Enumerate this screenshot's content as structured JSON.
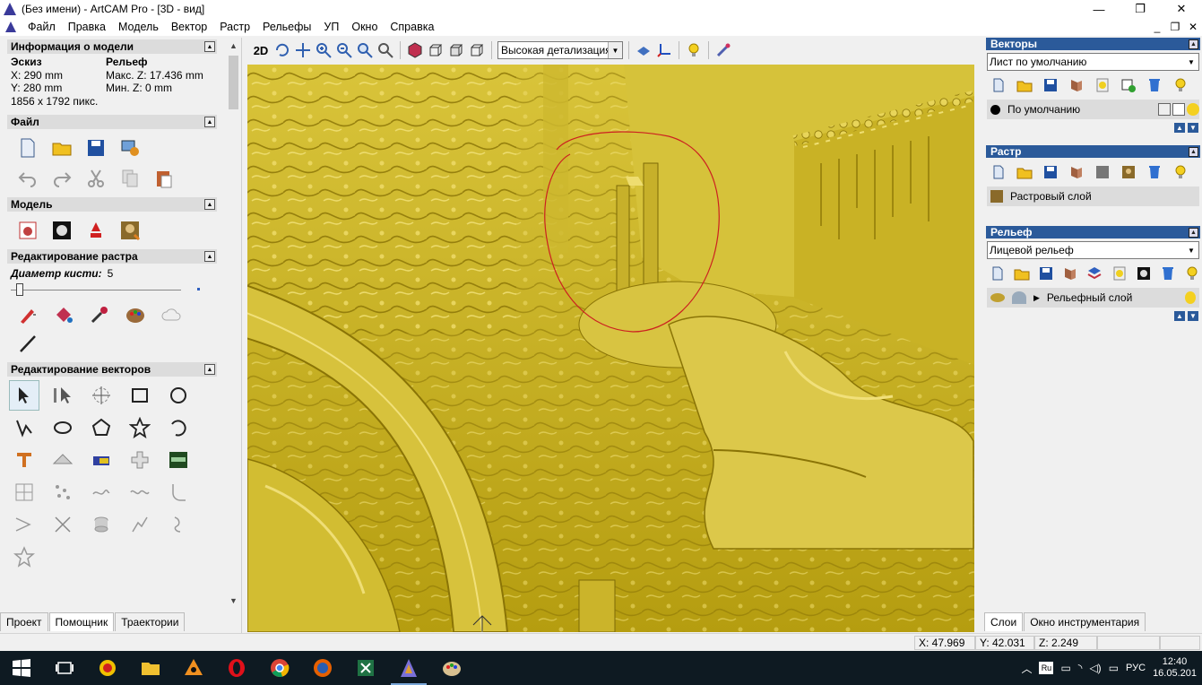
{
  "window": {
    "title": "(Без имени) - ArtCAM Pro - [3D - вид]",
    "minimize": "—",
    "maximize": "❐",
    "close": "✕"
  },
  "menu": [
    "Файл",
    "Правка",
    "Модель",
    "Вектор",
    "Растр",
    "Рельефы",
    "УП",
    "Окно",
    "Справка"
  ],
  "mdi_controls": [
    "_",
    "❐",
    "✕"
  ],
  "left_panel": {
    "model_info": {
      "header": "Информация о модели",
      "sketch_label": "Эскиз",
      "relief_label": "Рельеф",
      "x": "X: 290 mm",
      "maxz": "Макс. Z: 17.436 mm",
      "y": "Y: 280 mm",
      "minz": "Мин. Z: 0 mm",
      "pixels": "1856 x 1792 пикс."
    },
    "file_header": "Файл",
    "model_header": "Модель",
    "raster_edit_header": "Редактирование растра",
    "brush_label": "Диаметр кисти:",
    "brush_value": "5",
    "brush_fraction": 0.02,
    "vector_edit_header": "Редактирование векторов",
    "tabs": [
      "Проект",
      "Помощник",
      "Траектории"
    ],
    "active_tab": "Помощник"
  },
  "viewport_toolbar": {
    "mode_2d": "2D",
    "detail": "Высокая детализация"
  },
  "right_panel": {
    "vectors": {
      "header": "Векторы",
      "sheet": "Лист по умолчанию",
      "layer": "По умолчанию"
    },
    "raster": {
      "header": "Растр",
      "layer": "Растровый слой"
    },
    "relief": {
      "header": "Рельеф",
      "combined": "Лицевой рельеф",
      "layer": "Рельефный слой"
    },
    "tabs": [
      "Слои",
      "Окно инструментария"
    ],
    "active_tab": "Слои"
  },
  "status": {
    "x": "X: 47.969",
    "y": "Y: 42.031",
    "z": "Z: 2.249"
  },
  "taskbar": {
    "lang_badge": "Ru",
    "lang": "РУС",
    "time": "12:40",
    "date": "16.05.201"
  },
  "colors": {
    "relief": "#c9b020",
    "panel_header": "#2b5a9a",
    "annotation": "#cc2020"
  }
}
